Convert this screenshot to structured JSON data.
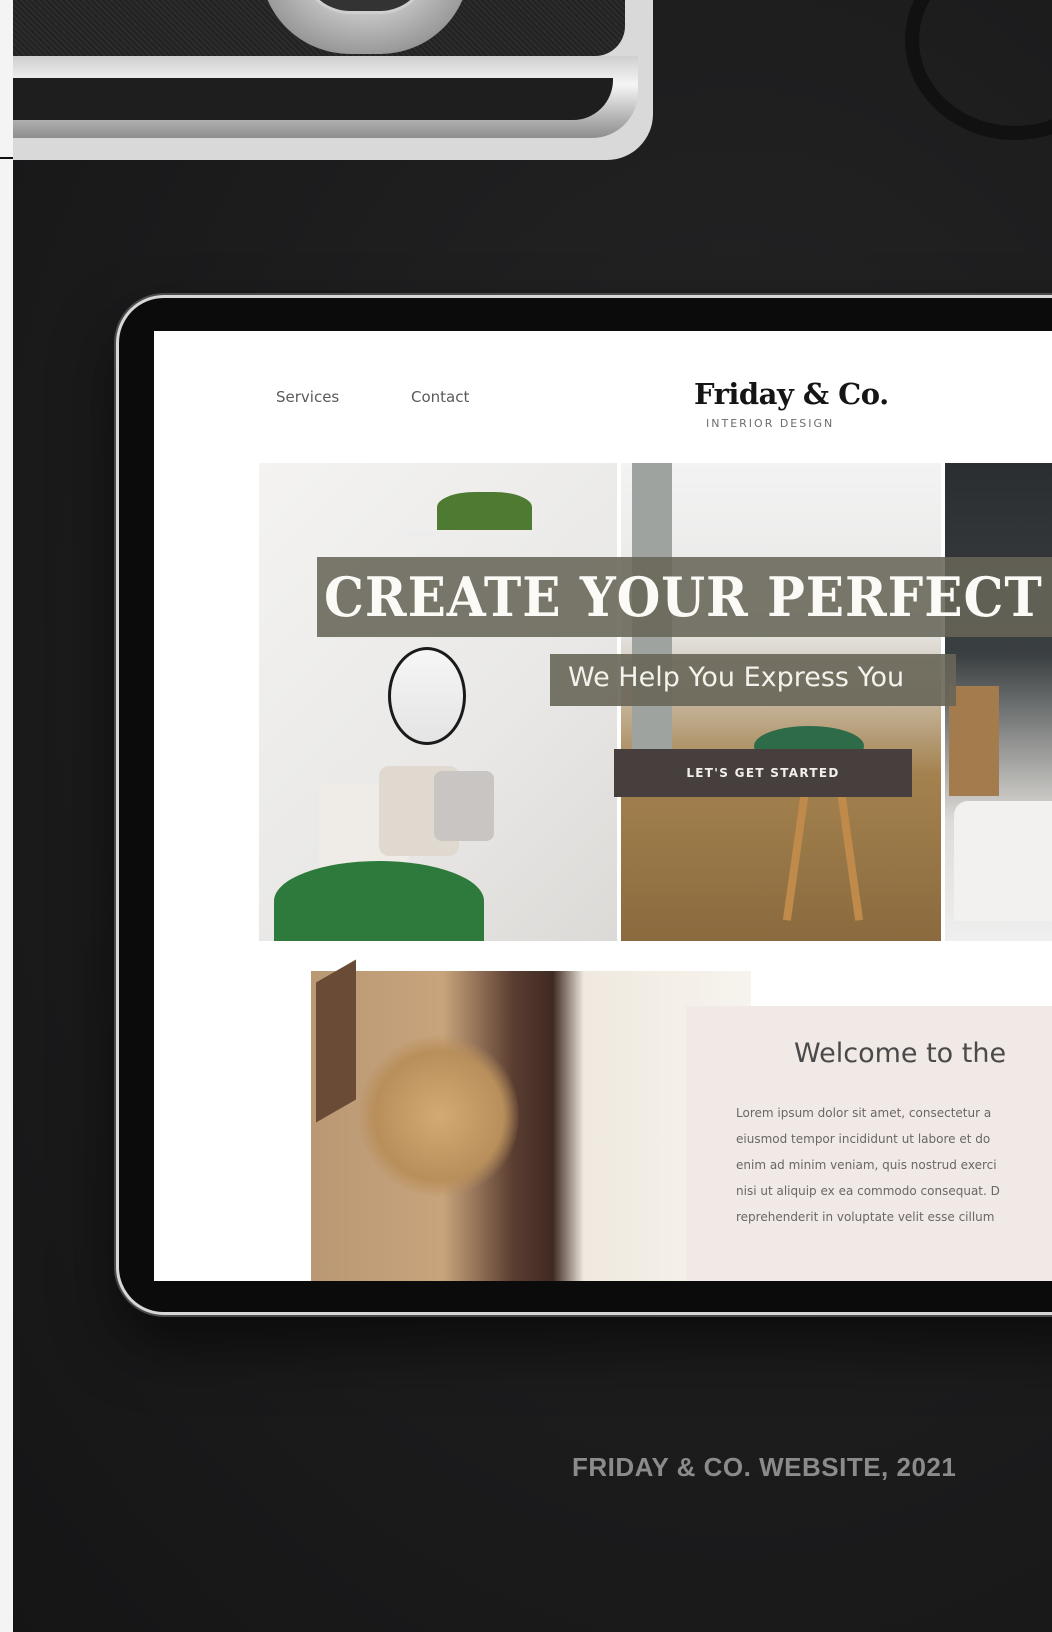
{
  "site": {
    "nav": {
      "services": "Services",
      "contact": "Contact"
    },
    "brand": {
      "name": "Friday & Co.",
      "tagline": "INTERIOR DESIGN"
    },
    "hero": {
      "title": "CREATE YOUR PERFECT",
      "subtitle": "We Help You Express You",
      "cta_label": "LET'S GET STARTED"
    },
    "welcome": {
      "heading": "Welcome to the",
      "lines": [
        "Lorem ipsum dolor sit amet, consectetur a",
        "eiusmod tempor incididunt ut labore et do",
        "enim ad minim veniam, quis nostrud exerci",
        "nisi ut aliquip ex ea commodo consequat. D",
        "reprehenderit in voluptate velit esse cillum"
      ]
    }
  },
  "caption": "FRIDAY & CO. WEBSITE, 2021",
  "colors": {
    "hero_overlay": "#686558",
    "cta_background": "#463f3d",
    "welcome_card": "#f1e9e6",
    "desk": "#1c1c1d"
  }
}
